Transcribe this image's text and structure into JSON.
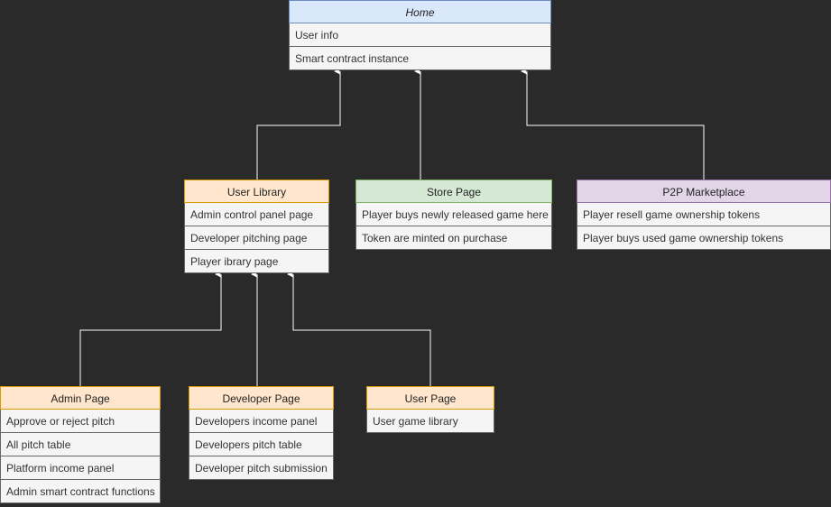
{
  "nodes": {
    "home": {
      "title": "Home",
      "items": [
        "User info",
        "Smart contract instance"
      ]
    },
    "user_library": {
      "title": "User Library",
      "items": [
        "Admin control panel page",
        "Developer pitching page",
        "Player ibrary page"
      ]
    },
    "store_page": {
      "title": "Store Page",
      "items": [
        "Player buys newly released game here",
        "Token are minted on purchase"
      ]
    },
    "p2p_marketplace": {
      "title": "P2P Marketplace",
      "items": [
        "Player resell game ownership tokens",
        "Player buys used game ownership tokens"
      ]
    },
    "admin_page": {
      "title": "Admin Page",
      "items": [
        "Approve or reject pitch",
        "All pitch table",
        "Platform income panel",
        "Admin smart contract functions"
      ]
    },
    "developer_page": {
      "title": "Developer Page",
      "items": [
        "Developers income panel",
        "Developers pitch table",
        "Developer pitch submission"
      ]
    },
    "user_page": {
      "title": "User Page",
      "items": [
        "User game library"
      ]
    }
  },
  "edges": [
    {
      "from": "User Library",
      "to": "Home"
    },
    {
      "from": "Store Page",
      "to": "Home"
    },
    {
      "from": "P2P Marketplace",
      "to": "Home"
    },
    {
      "from": "Admin Page",
      "to": "User Library"
    },
    {
      "from": "Developer Page",
      "to": "User Library"
    },
    {
      "from": "User Page",
      "to": "User Library"
    }
  ]
}
